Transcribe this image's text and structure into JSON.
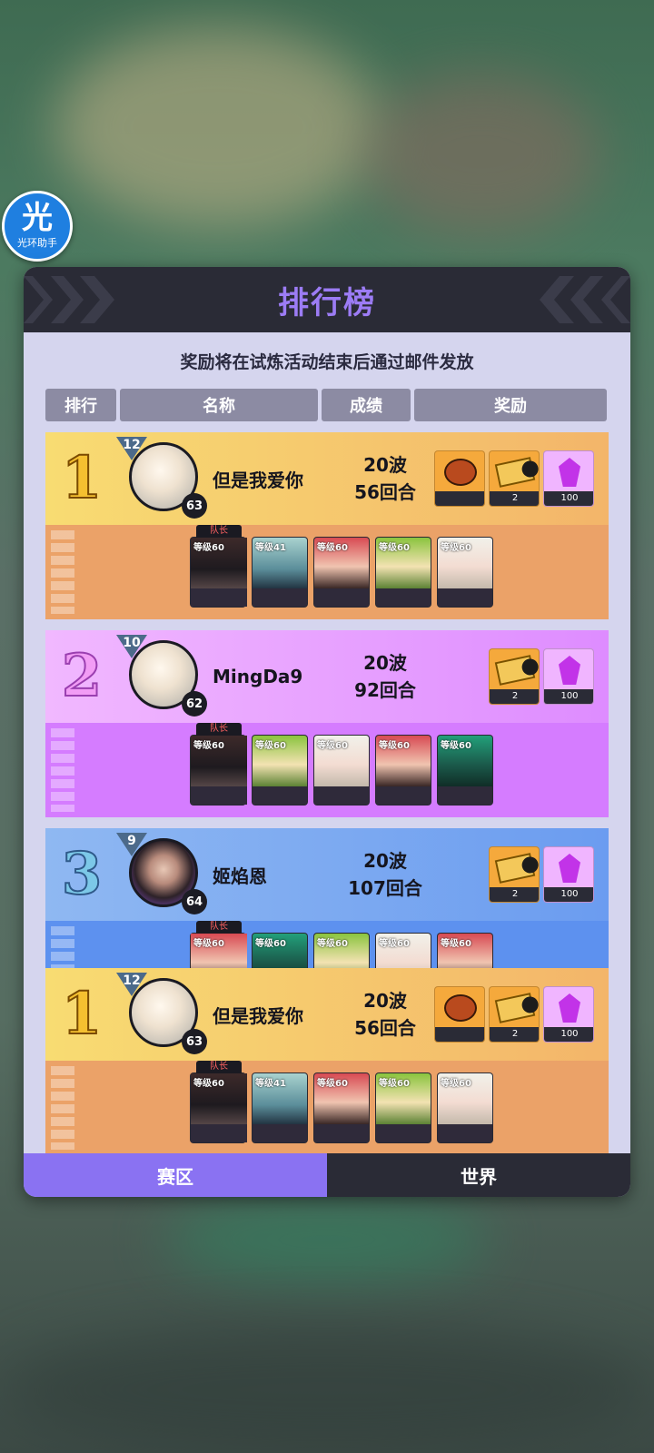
{
  "assistant": {
    "glyph": "光",
    "label": "光环助手"
  },
  "panel": {
    "title": "排行榜",
    "notice": "奖励将在试炼活动结束后通过邮件发放",
    "columns": {
      "rank": "排行",
      "name": "名称",
      "score": "成绩",
      "reward": "奖励"
    }
  },
  "entries": [
    {
      "rank": "1",
      "level": "12",
      "power": "63",
      "name": "但是我爱你",
      "waves": "20波",
      "rounds": "56回合",
      "rewards": [
        {
          "icon": "pet-icon",
          "count": ""
        },
        {
          "icon": "ticket-icon",
          "count": "2"
        },
        {
          "icon": "gem-icon",
          "count": "100"
        }
      ],
      "captain_label": "队长",
      "heroes": [
        {
          "level": "等级60"
        },
        {
          "level": "等级41"
        },
        {
          "level": "等级60"
        },
        {
          "level": "等级60"
        },
        {
          "level": "等级60"
        }
      ]
    },
    {
      "rank": "2",
      "level": "10",
      "power": "62",
      "name": "MingDa9",
      "waves": "20波",
      "rounds": "92回合",
      "rewards": [
        {
          "icon": "ticket-icon",
          "count": "2"
        },
        {
          "icon": "gem-icon",
          "count": "100"
        }
      ],
      "captain_label": "队长",
      "heroes": [
        {
          "level": "等级60"
        },
        {
          "level": "等级60"
        },
        {
          "level": "等级60"
        },
        {
          "level": "等级60"
        },
        {
          "level": "等级60"
        }
      ]
    },
    {
      "rank": "3",
      "level": "9",
      "power": "64",
      "name": "姬焰恩",
      "waves": "20波",
      "rounds": "107回合",
      "rewards": [
        {
          "icon": "ticket-icon",
          "count": "2"
        },
        {
          "icon": "gem-icon",
          "count": "100"
        }
      ],
      "captain_label": "队长",
      "heroes": [
        {
          "level": "等级60"
        },
        {
          "level": "等级60"
        },
        {
          "level": "等级60"
        },
        {
          "level": "等级60"
        },
        {
          "level": "等级60"
        }
      ]
    }
  ],
  "self_entry": {
    "rank": "1",
    "level": "12",
    "power": "63",
    "name": "但是我爱你",
    "waves": "20波",
    "rounds": "56回合",
    "rewards": [
      {
        "icon": "pet-icon",
        "count": ""
      },
      {
        "icon": "ticket-icon",
        "count": "2"
      },
      {
        "icon": "gem-icon",
        "count": "100"
      }
    ],
    "captain_label": "队长",
    "heroes": [
      {
        "level": "等级60"
      },
      {
        "level": "等级41"
      },
      {
        "level": "等级60"
      },
      {
        "level": "等级60"
      },
      {
        "level": "等级60"
      }
    ]
  },
  "tabs": {
    "region": "赛区",
    "world": "世界"
  },
  "colors": {
    "gold_row": "#f7c85b",
    "gold_team": "#eba268",
    "pink_row": "#e9a2ff",
    "pink_team": "#d57cff",
    "blue_row": "#76a7ee",
    "blue_team": "#5d91ef",
    "accent": "#8a72f2",
    "header": "#2a2b36"
  }
}
